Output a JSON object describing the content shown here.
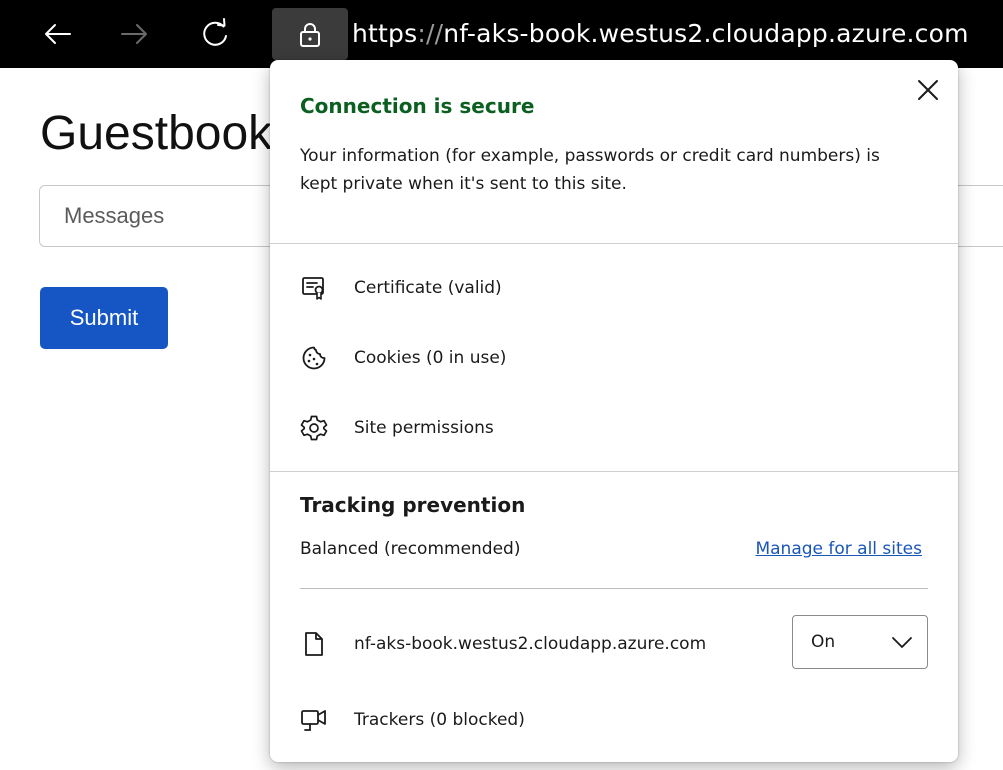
{
  "browser": {
    "url_scheme": "https",
    "url_separator": "://",
    "url_host": "nf-aks-book.westus2.cloudapp.azure.com"
  },
  "page": {
    "title": "Guestbook",
    "messages_placeholder": "Messages",
    "submit_label": "Submit"
  },
  "flyout": {
    "title": "Connection is secure",
    "description": "Your information (for example, passwords or credit card numbers) is kept private when it's sent to this site.",
    "items": [
      {
        "label": "Certificate (valid)",
        "icon": "certificate-icon"
      },
      {
        "label": "Cookies (0 in use)",
        "icon": "cookie-icon"
      },
      {
        "label": "Site permissions",
        "icon": "gear-icon"
      }
    ],
    "tracking": {
      "title": "Tracking prevention",
      "mode": "Balanced (recommended)",
      "manage_link": "Manage for all sites",
      "site": "nf-aks-book.westus2.cloudapp.azure.com",
      "site_setting": "On",
      "trackers": "Trackers (0 blocked)"
    }
  },
  "colors": {
    "title_green": "#0b5f20",
    "link_blue": "#1a56b8",
    "submit_blue": "#1556c4"
  }
}
